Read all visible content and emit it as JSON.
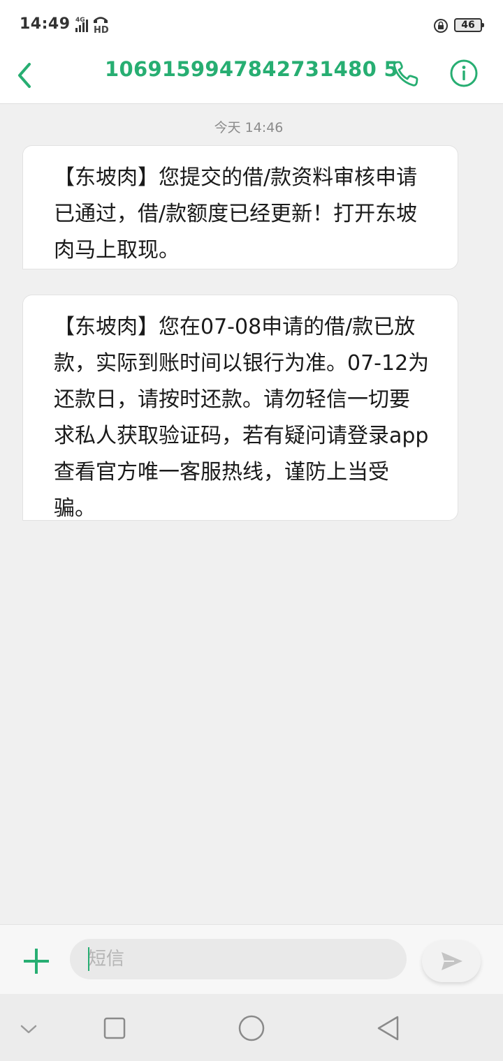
{
  "status_bar": {
    "time": "14:49",
    "network": "4G",
    "hd": "HD",
    "battery": "46"
  },
  "header": {
    "contact": "1069159947842731480 5"
  },
  "conversation": {
    "timestamp": "今天 14:46",
    "messages": [
      {
        "text": "【东坡肉】您提交的借/款资料审核申请已通过，借/款额度已经更新！打开东坡肉马上取现。"
      },
      {
        "text": "【东坡肉】您在07-08申请的借/款已放款，实际到账时间以银行为准。07-12为还款日，请按时还款。请勿轻信一切要求私人获取验证码，若有疑问请登录app查看官方唯一客服热线，谨防上当受骗。"
      }
    ]
  },
  "composer": {
    "placeholder": "短信"
  },
  "icons": {
    "back": "chevron-left-icon",
    "call": "phone-icon",
    "info": "info-icon",
    "add": "plus-icon",
    "send": "send-icon",
    "nav_down": "chevron-down-icon",
    "nav_recent": "square-icon",
    "nav_home": "circle-icon",
    "nav_back": "triangle-back-icon"
  },
  "colors": {
    "accent": "#27ae72",
    "background": "#f0f0f0",
    "bubble": "#ffffff"
  }
}
